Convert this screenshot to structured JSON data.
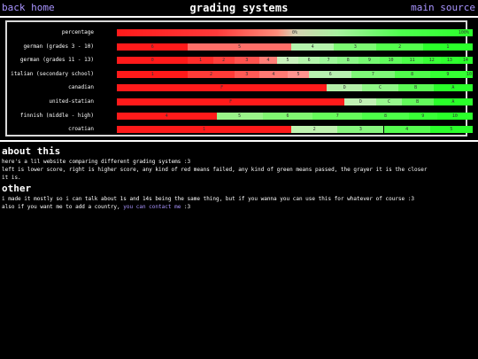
{
  "nav": {
    "back_home": "back home",
    "title": "grading systems",
    "main_source": "main source"
  },
  "colors": {
    "accent": "#a994ff",
    "fail_red": "#ff1a1a",
    "pass_green": "#2aff2a",
    "line_white": "#ffffff"
  },
  "chart": {
    "rows": [
      {
        "label": "percentage",
        "segments": [
          {
            "text": "0%",
            "from": 0,
            "to": 1,
            "bg": "linear-gradient(to right,#ff1a1a 0%,#ff3a3a 28%,#ff8c7a 45%,#d7d0b2 50%,#a8f0a0 62%,#4dff4d 80%,#2aff2a 100%)"
          },
          {
            "text": "100%",
            "from": 0.95,
            "to": 1,
            "bg": "transparent"
          }
        ]
      },
      {
        "label": "german (grades 3 - 10)",
        "segments": [
          {
            "text": "6",
            "from": 0,
            "to": 0.2,
            "bg": "#ff1a1a"
          },
          {
            "text": "5",
            "from": 0.2,
            "to": 0.49,
            "bg": "#ff6f68"
          },
          {
            "text": "4",
            "from": 0.49,
            "to": 0.61,
            "bg": "#b5f4ad"
          },
          {
            "text": "3",
            "from": 0.61,
            "to": 0.73,
            "bg": "#7cfb73"
          },
          {
            "text": "2",
            "from": 0.73,
            "to": 0.86,
            "bg": "#53ff4d"
          },
          {
            "text": "1",
            "from": 0.86,
            "to": 1,
            "bg": "#2aff2a"
          }
        ]
      },
      {
        "label": "german (grades 11 - 13)",
        "segments": [
          {
            "text": "0",
            "from": 0,
            "to": 0.2,
            "bg": "#ff1a1a"
          },
          {
            "text": "1",
            "from": 0.2,
            "to": 0.27,
            "bg": "#ff2c2a"
          },
          {
            "text": "2",
            "from": 0.27,
            "to": 0.33,
            "bg": "#ff3f3c"
          },
          {
            "text": "3",
            "from": 0.33,
            "to": 0.4,
            "bg": "#ff534f"
          },
          {
            "text": "4",
            "from": 0.4,
            "to": 0.45,
            "bg": "#ff7f78"
          },
          {
            "text": "5",
            "from": 0.45,
            "to": 0.51,
            "bg": "#c9f2bd"
          },
          {
            "text": "6",
            "from": 0.51,
            "to": 0.57,
            "bg": "#b4f5ac"
          },
          {
            "text": "7",
            "from": 0.57,
            "to": 0.62,
            "bg": "#9ef79a"
          },
          {
            "text": "8",
            "from": 0.62,
            "to": 0.68,
            "bg": "#8cf788"
          },
          {
            "text": "9",
            "from": 0.68,
            "to": 0.74,
            "bg": "#76f972"
          },
          {
            "text": "10",
            "from": 0.74,
            "to": 0.8,
            "bg": "#60fb5c"
          },
          {
            "text": "11",
            "from": 0.8,
            "to": 0.86,
            "bg": "#4cff49"
          },
          {
            "text": "12",
            "from": 0.86,
            "to": 0.91,
            "bg": "#38ff36"
          },
          {
            "text": "13",
            "from": 0.91,
            "to": 0.96,
            "bg": "#2fff2e"
          },
          {
            "text": "14",
            "from": 0.96,
            "to": 1.0,
            "bg": "#2aff2a"
          }
        ]
      },
      {
        "label": "italian (secondary school)",
        "segments": [
          {
            "text": "1",
            "from": 0,
            "to": 0.2,
            "bg": "#ff1a1a"
          },
          {
            "text": "2",
            "from": 0.2,
            "to": 0.33,
            "bg": "#ff3b38"
          },
          {
            "text": "3",
            "from": 0.33,
            "to": 0.4,
            "bg": "#ff5a56"
          },
          {
            "text": "4",
            "from": 0.4,
            "to": 0.48,
            "bg": "#ff7a74"
          },
          {
            "text": "5",
            "from": 0.48,
            "to": 0.54,
            "bg": "#ff938f"
          },
          {
            "text": "6",
            "from": 0.54,
            "to": 0.66,
            "bg": "#b7f1b0"
          },
          {
            "text": "7",
            "from": 0.66,
            "to": 0.78,
            "bg": "#7ff778"
          },
          {
            "text": "8",
            "from": 0.78,
            "to": 0.88,
            "bg": "#50fc4b"
          },
          {
            "text": "9",
            "from": 0.88,
            "to": 0.98,
            "bg": "#35ff33"
          },
          {
            "text": "10",
            "from": 0.98,
            "to": 1.0,
            "bg": "#2aff2a"
          }
        ]
      },
      {
        "label": "canadian",
        "segments": [
          {
            "text": "F",
            "from": 0,
            "to": 0.59,
            "bg": "#ff1a1a"
          },
          {
            "text": "D",
            "from": 0.59,
            "to": 0.69,
            "bg": "#b5f0aa"
          },
          {
            "text": "C",
            "from": 0.69,
            "to": 0.79,
            "bg": "#8ff786"
          },
          {
            "text": "B",
            "from": 0.79,
            "to": 0.89,
            "bg": "#5cfb55"
          },
          {
            "text": "A",
            "from": 0.89,
            "to": 1.0,
            "bg": "#2aff2a"
          }
        ]
      },
      {
        "label": "united-statian",
        "segments": [
          {
            "text": "F",
            "from": 0,
            "to": 0.64,
            "bg": "#ff1a1a"
          },
          {
            "text": "D",
            "from": 0.64,
            "to": 0.73,
            "bg": "#c1f1b4"
          },
          {
            "text": "C",
            "from": 0.73,
            "to": 0.8,
            "bg": "#97f88d"
          },
          {
            "text": "B",
            "from": 0.8,
            "to": 0.89,
            "bg": "#63fb5b"
          },
          {
            "text": "A",
            "from": 0.89,
            "to": 1.0,
            "bg": "#2aff2a"
          }
        ]
      },
      {
        "label": "finnish (middle - high)",
        "segments": [
          {
            "text": "4",
            "from": 0,
            "to": 0.28,
            "bg": "#ff1a1a"
          },
          {
            "text": "5",
            "from": 0.28,
            "to": 0.41,
            "bg": "#99f489"
          },
          {
            "text": "6",
            "from": 0.41,
            "to": 0.55,
            "bg": "#80f771"
          },
          {
            "text": "7",
            "from": 0.55,
            "to": 0.69,
            "bg": "#65fb5a"
          },
          {
            "text": "8",
            "from": 0.69,
            "to": 0.82,
            "bg": "#4cff48"
          },
          {
            "text": "9",
            "from": 0.82,
            "to": 0.9,
            "bg": "#38ff36"
          },
          {
            "text": "10",
            "from": 0.9,
            "to": 1.0,
            "bg": "#2aff2a"
          }
        ]
      },
      {
        "label": "croatian",
        "segments": [
          {
            "text": "1",
            "from": 0,
            "to": 0.49,
            "bg": "#ff1a1a"
          },
          {
            "text": "2",
            "from": 0.49,
            "to": 0.62,
            "bg": "#bff2b0"
          },
          {
            "text": "3",
            "from": 0.62,
            "to": 0.75,
            "bg": "#88f67f"
          },
          {
            "text": "4",
            "from": 0.75,
            "to": 0.88,
            "bg": "#55fc4f"
          },
          {
            "text": "5",
            "from": 0.88,
            "to": 1.0,
            "bg": "#2aff2a"
          }
        ]
      }
    ]
  },
  "about": {
    "title": "about this",
    "line1": "here's a lil website comparing different grading systems :3",
    "line2": "left is lower score, right is higher score, any kind of red means failed, any kind of green means passed, the grayer it is the closer",
    "line3": "it is."
  },
  "other": {
    "title": "other",
    "line1": "i made it mostly so i can talk about 1s and 14s being the same thing, but if you wanna you can use this for whatever of course :3",
    "line2_prefix": "also if you want me to add a country, ",
    "line2_link": "you can contact me",
    "line2_suffix": " :3"
  }
}
